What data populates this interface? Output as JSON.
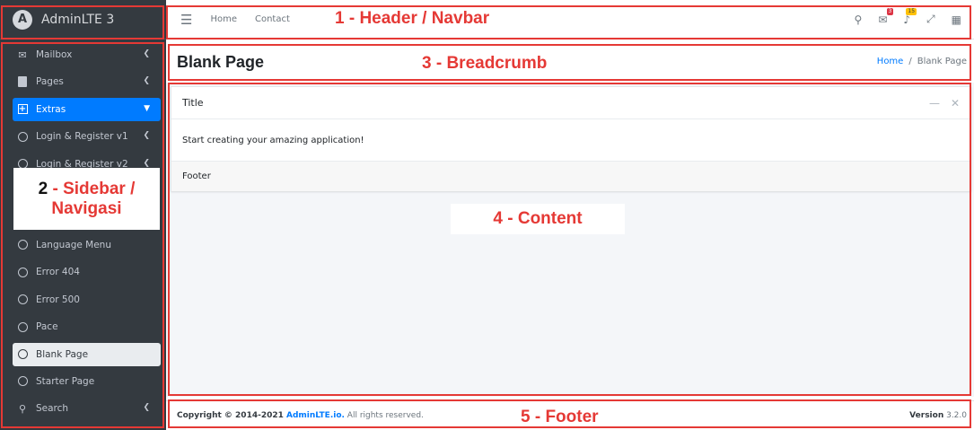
{
  "brand": {
    "logo_letter": "A",
    "name": "AdminLTE 3"
  },
  "sidebar": {
    "items": [
      {
        "label": "Mailbox",
        "icon": "envelope-icon"
      },
      {
        "label": "Pages",
        "icon": "pages-icon"
      },
      {
        "label": "Extras",
        "icon": "plus-square-icon",
        "active": true
      },
      {
        "label": "Login & Register v1",
        "icon": "circle-icon"
      },
      {
        "label": "Login & Register v2",
        "icon": "circle-icon"
      },
      {
        "label": "Language Menu",
        "icon": "circle-icon"
      },
      {
        "label": "Error 404",
        "icon": "circle-icon"
      },
      {
        "label": "Error 500",
        "icon": "circle-icon"
      },
      {
        "label": "Pace",
        "icon": "circle-icon"
      },
      {
        "label": "Blank Page",
        "icon": "circle-icon",
        "selected": true
      },
      {
        "label": "Starter Page",
        "icon": "circle-icon"
      },
      {
        "label": "Search",
        "icon": "search-icon"
      }
    ]
  },
  "header": {
    "links": [
      "Home",
      "Contact"
    ],
    "messages_badge": "3",
    "notifications_badge": "15"
  },
  "page": {
    "title": "Blank Page",
    "breadcrumb": [
      "Home",
      "Blank Page"
    ]
  },
  "card": {
    "title": "Title",
    "body": "Start creating your amazing application!",
    "footer": "Footer"
  },
  "footer": {
    "copyright_prefix": "Copyright © 2014-2021 ",
    "brand_link": "AdminLTE.io.",
    "copyright_suffix": " All rights reserved.",
    "version_label": "Version",
    "version_value": " 3.2.0"
  },
  "annotations": {
    "header": "1 - Header / Navbar",
    "sidebar_num": "2",
    "sidebar_a": " - Sidebar /",
    "sidebar_b": "Navigasi",
    "breadcrumb": "3 - Breadcrumb",
    "content": "4 - Content",
    "footer": "5 - Footer"
  },
  "colors": {
    "annotation": "#e53935",
    "accent": "#007bff",
    "sidebar_bg": "#343a40"
  }
}
